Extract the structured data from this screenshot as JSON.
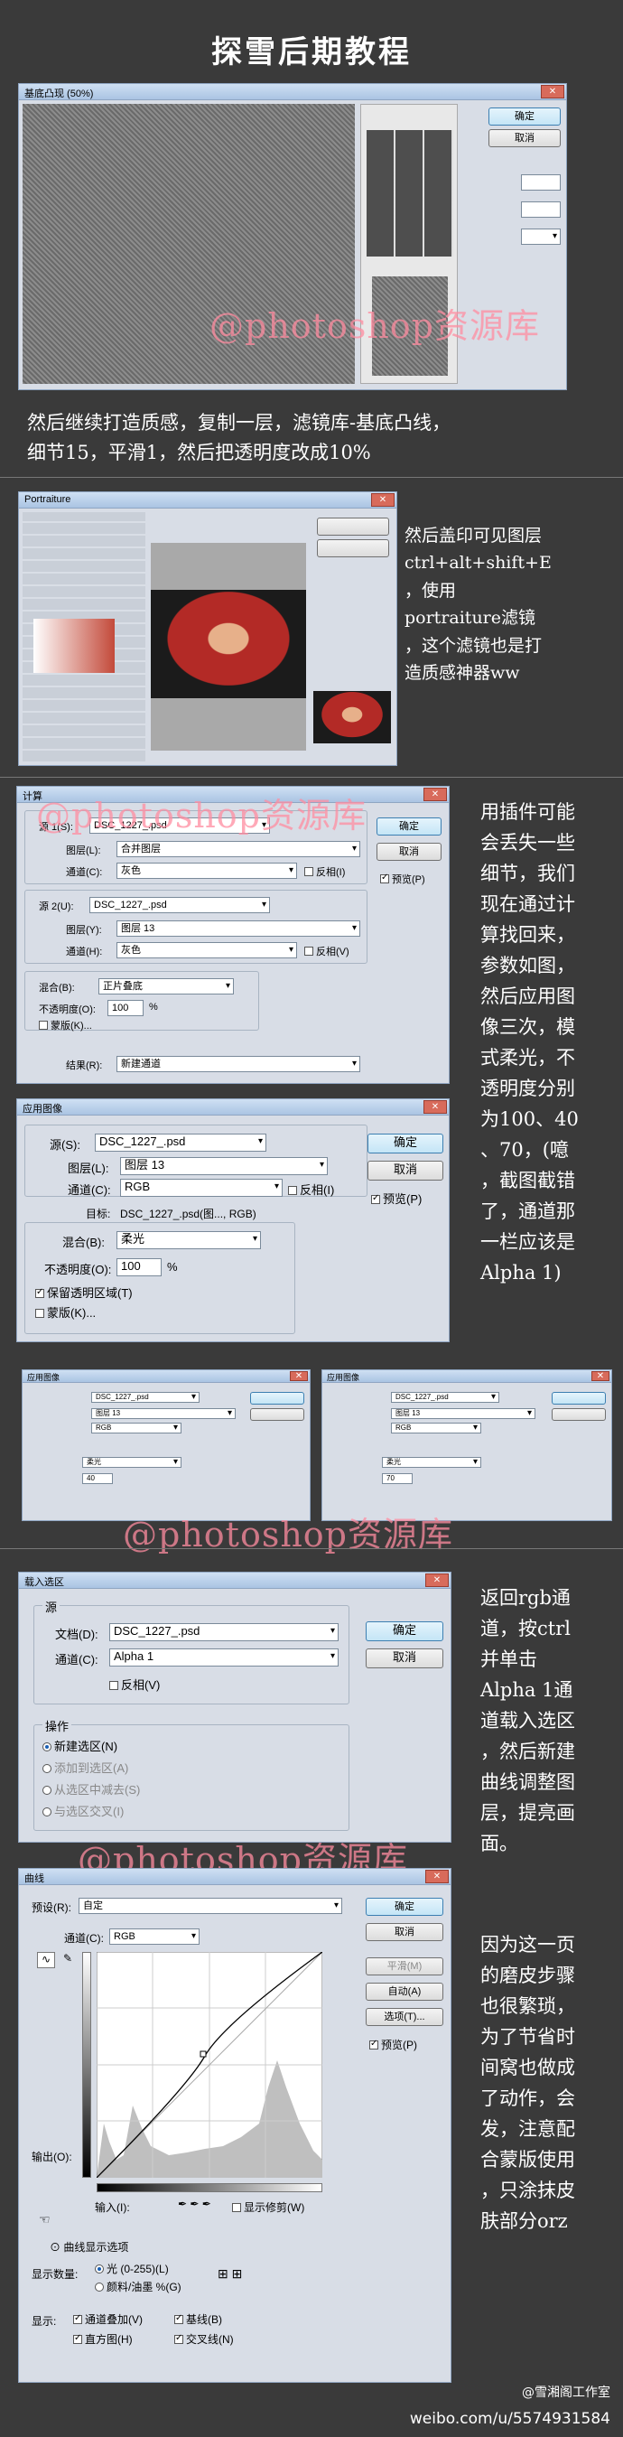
{
  "title": "探雪后期教程",
  "watermark": "@photoshop资源库",
  "section1": {
    "caption_lines": [
      "然后继续打造质感，复制一层，滤镜库-基底凸线，",
      "细节15，平滑1，然后把透明度改成10%"
    ],
    "window_title": "基底凸现 (50%)",
    "ok": "确定",
    "cancel": "取消"
  },
  "section2": {
    "caption_lines": [
      "然后盖印可见图层",
      "ctrl+alt+shift+E",
      "，使用",
      "portraiture滤镜",
      "，这个滤镜也是打",
      "造质感神器ww"
    ],
    "window_title": "Portraiture"
  },
  "section3": {
    "caption_lines": [
      "用插件可能",
      "会丢失一些",
      "细节，我们",
      "现在通过计",
      "算找回来，",
      "参数如图，",
      "然后应用图",
      "像三次，模",
      "式柔光，不",
      "透明度分别",
      "为100、40",
      "、70，(噫",
      "，截图截错",
      "了，通道那",
      "一栏应该是",
      "Alpha 1)"
    ],
    "calc": {
      "title": "计算",
      "src1_label": "源 1(S):",
      "src1_val": "DSC_1227_.psd",
      "layer_label": "图层(L):",
      "layer1_val": "合并图层",
      "channel_label": "通道(C):",
      "channel1_val": "灰色",
      "invert_label": "反相(I)",
      "src2_label": "源 2(U):",
      "src2_val": "DSC_1227_.psd",
      "layer_label2": "图层(Y):",
      "layer2_val": "图层 13",
      "channel_label2": "通道(H):",
      "channel2_val": "灰色",
      "invert_label2": "反相(V)",
      "blend_label": "混合(B):",
      "blend_val": "正片叠底",
      "opacity_label": "不透明度(O):",
      "opacity_val": "100",
      "pct": "%",
      "mask_label": "蒙版(K)...",
      "result_label": "结果(R):",
      "result_val": "新建通道",
      "ok": "确定",
      "cancel": "取消",
      "preview": "预览(P)"
    },
    "apply": {
      "title": "应用图像",
      "src_label": "源(S):",
      "src_val": "DSC_1227_.psd",
      "layer_label": "图层(L):",
      "layer_val": "图层 13",
      "channel_label": "通道(C):",
      "channel_val": "RGB",
      "invert_label": "反相(I)",
      "target_label": "目标:",
      "target_val": "DSC_1227_.psd(图..., RGB)",
      "blend_label": "混合(B):",
      "blend_val": "柔光",
      "opacity_label": "不透明度(O):",
      "opacity_val": "100",
      "pct": "%",
      "preserve_label": "保留透明区域(T)",
      "mask_label": "蒙版(K)...",
      "ok": "确定",
      "cancel": "取消",
      "preview": "预览(P)"
    },
    "apply_small": [
      {
        "title": "应用图像",
        "src_val": "DSC_1227_.psd",
        "layer_val": "图层 13",
        "channel_val": "RGB",
        "blend_val": "柔光",
        "opacity_val": "40"
      },
      {
        "title": "应用图像",
        "src_val": "DSC_1227_.psd",
        "layer_val": "图层 13",
        "channel_val": "RGB",
        "blend_val": "柔光",
        "opacity_val": "70"
      }
    ]
  },
  "section4": {
    "caption_a": [
      "返回rgb通",
      "道，按ctrl",
      "并单击",
      "Alpha 1通",
      "道载入选区",
      "，然后新建",
      "曲线调整图",
      "层，提亮画",
      "面。"
    ],
    "caption_b": [
      "因为这一页",
      "的磨皮步骤",
      "也很繁琐，",
      "为了节省时",
      "间窝也做成",
      "了动作，会",
      "发，注意配",
      "合蒙版使用",
      "，只涂抹皮",
      "肤部分orz"
    ],
    "load": {
      "title": "载入选区",
      "source_group": "源",
      "doc_label": "文档(D):",
      "doc_val": "DSC_1227_.psd",
      "channel_label": "通道(C):",
      "channel_val": "Alpha 1",
      "invert_label": "反相(V)",
      "op_group": "操作",
      "ops": [
        "新建选区(N)",
        "添加到选区(A)",
        "从选区中减去(S)",
        "与选区交叉(I)"
      ],
      "ok": "确定",
      "cancel": "取消"
    },
    "curves": {
      "title": "曲线",
      "preset_label": "预设(R):",
      "preset_val": "自定",
      "channel_label": "通道(C):",
      "channel_val": "RGB",
      "output_label": "输出(O):",
      "input_label": "输入(I):",
      "ok": "确定",
      "cancel": "取消",
      "smooth": "平滑(M)",
      "auto": "自动(A)",
      "options": "选项(T)...",
      "preview": "预览(P)",
      "show_clip": "显示修剪(W)",
      "display_group": "曲线显示选项",
      "amount_label": "显示数量:",
      "light": "光 (0-255)(L)",
      "pigment": "颜料/油墨 %(G)",
      "show_label": "显示:",
      "overlay": "通道叠加(V)",
      "baseline": "基线(B)",
      "histogram": "直方图(H)",
      "intersection": "交叉线(N)"
    }
  },
  "footer": {
    "weibo": "@雪湘阁工作室",
    "url": "weibo.com/u/5574931584"
  }
}
